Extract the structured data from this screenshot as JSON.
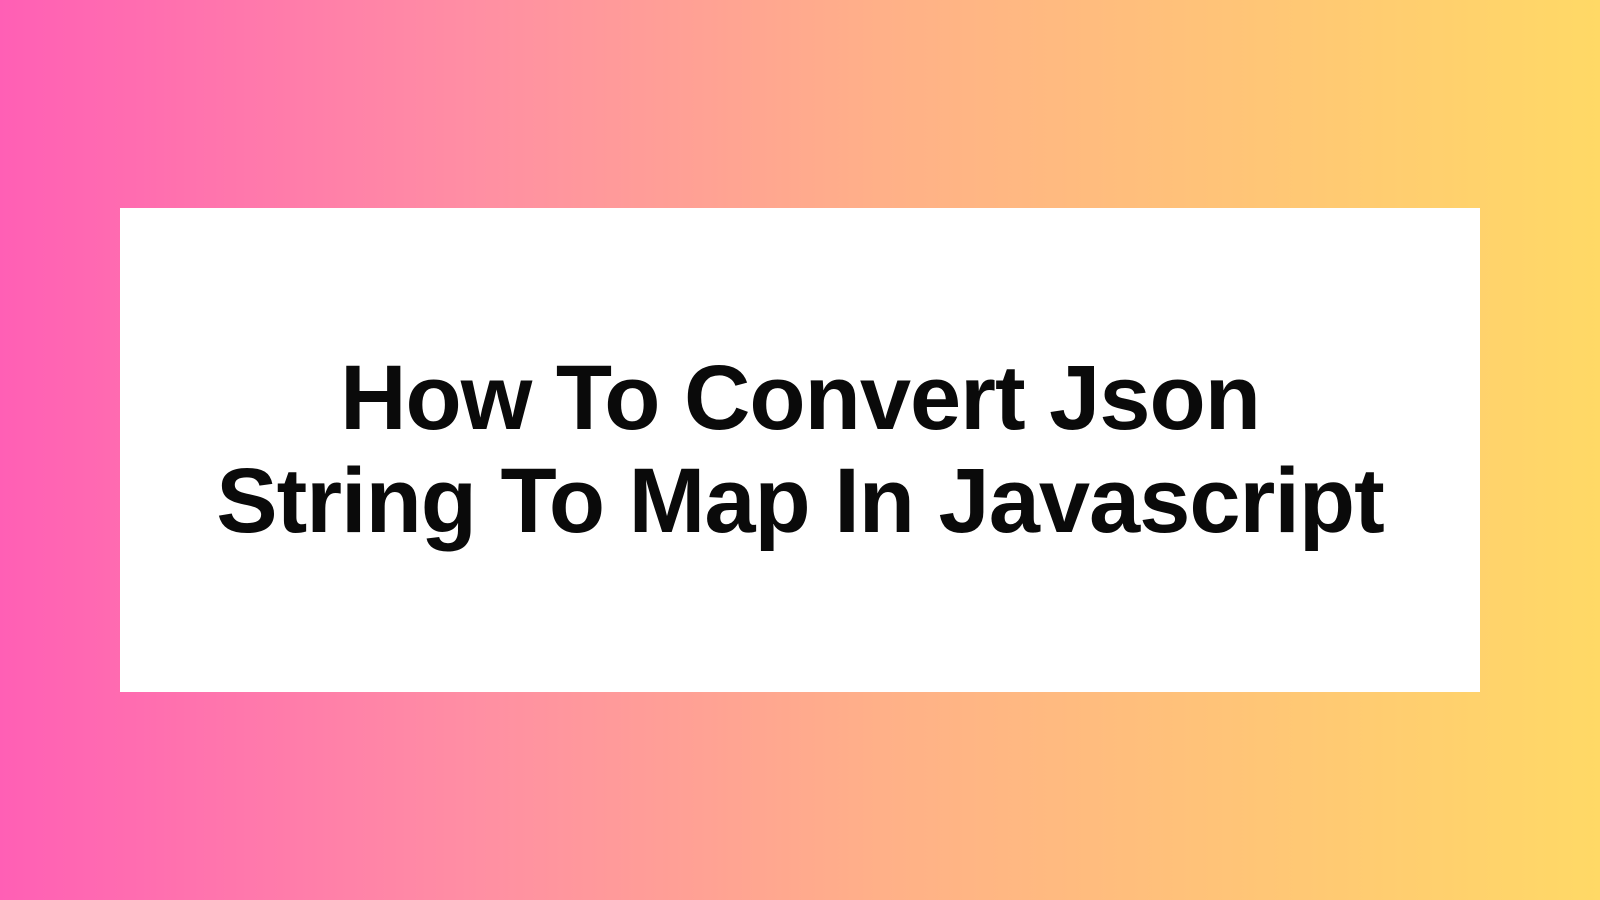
{
  "title": "How To Convert Json String To Map In Javascript",
  "colors": {
    "gradient_start": "#ff5fb5",
    "gradient_mid1": "#ff8fa3",
    "gradient_mid2": "#ffb088",
    "gradient_end": "#ffd966",
    "card_bg": "#ffffff",
    "text": "#0a0a0a"
  }
}
